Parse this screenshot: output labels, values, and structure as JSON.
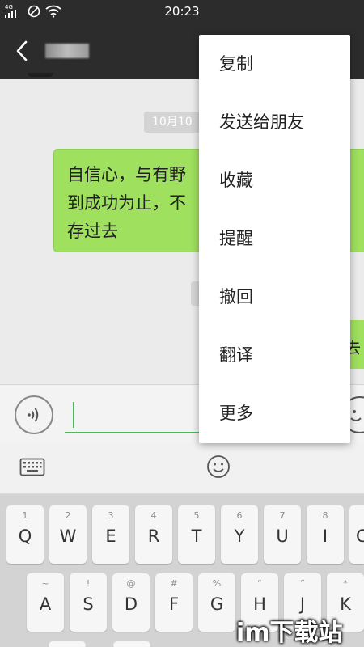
{
  "status_bar": {
    "network": "4G",
    "time": "20:23"
  },
  "header": {
    "contact_name": "████"
  },
  "chat": {
    "time_chip": "10月10",
    "bubble_lines": [
      "自信心，与有野",
      "到成功为止，不",
      "存过去"
    ],
    "bubble2_text": "去"
  },
  "context_menu": {
    "items": [
      "复制",
      "发送给朋友",
      "收藏",
      "提醒",
      "撤回",
      "翻译",
      "更多"
    ]
  },
  "keyboard": {
    "row1": [
      {
        "num": "1",
        "ch": "Q"
      },
      {
        "num": "2",
        "ch": "W"
      },
      {
        "num": "3",
        "ch": "E"
      },
      {
        "num": "4",
        "ch": "R"
      },
      {
        "num": "5",
        "ch": "T"
      },
      {
        "num": "6",
        "ch": "Y"
      },
      {
        "num": "7",
        "ch": "U"
      },
      {
        "num": "8",
        "ch": "I"
      },
      {
        "num": "",
        "ch": "O"
      }
    ],
    "row2": [
      {
        "num": "~",
        "ch": "A"
      },
      {
        "num": "!",
        "ch": "S"
      },
      {
        "num": "@",
        "ch": "D"
      },
      {
        "num": "#",
        "ch": "F"
      },
      {
        "num": "%",
        "ch": "G"
      },
      {
        "num": "“",
        "ch": "H"
      },
      {
        "num": "”",
        "ch": "J"
      },
      {
        "num": "*",
        "ch": "K"
      }
    ]
  },
  "watermark": "im下载站",
  "colors": {
    "header_bg": "#2c2c2c",
    "bubble_green": "#9fe05f",
    "input_accent": "#4cb85a"
  }
}
